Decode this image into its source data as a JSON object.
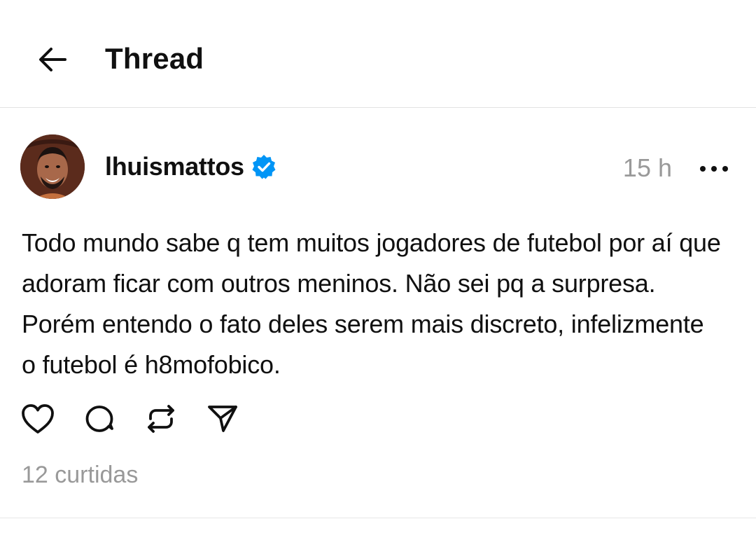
{
  "header": {
    "title": "Thread",
    "back_icon": "arrow-left-icon"
  },
  "post": {
    "username": "lhuismattos",
    "verified": true,
    "verified_color": "#0095f6",
    "time": "15 h",
    "more_icon": "more-horizontal-icon",
    "text": "Todo mundo sabe q tem muitos jogadores de futebol por aí que adoram ficar com outros meninos. Não sei pq a surpresa. Porém entendo o fato deles serem mais discreto, infelizmente o futebol é h8mofobico.",
    "actions": [
      "heart-icon",
      "comment-icon",
      "repost-icon",
      "share-icon"
    ],
    "likes": "12 curtidas"
  },
  "colors": {
    "text": "#101010",
    "muted": "#999999",
    "divider": "#e2e2e2"
  }
}
